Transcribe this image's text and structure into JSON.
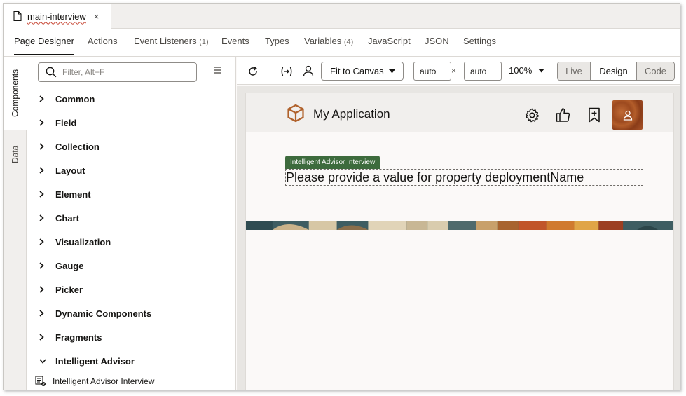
{
  "file_tab": {
    "name": "main-interview",
    "close_glyph": "×"
  },
  "designer_tabs": [
    {
      "label": "Page Designer",
      "count": ""
    },
    {
      "label": "Actions",
      "count": ""
    },
    {
      "label": "Event Listeners",
      "count": "(1)"
    },
    {
      "label": "Events",
      "count": ""
    },
    {
      "label": "Types",
      "count": ""
    },
    {
      "label": "Variables",
      "count": "(4)"
    },
    {
      "label": "JavaScript",
      "count": ""
    },
    {
      "label": "JSON",
      "count": ""
    },
    {
      "label": "Settings",
      "count": ""
    }
  ],
  "rail": {
    "components": "Components",
    "data": "Data"
  },
  "panel": {
    "search_placeholder": "Filter, Alt+F",
    "categories": [
      "Common",
      "Field",
      "Collection",
      "Layout",
      "Element",
      "Chart",
      "Visualization",
      "Gauge",
      "Picker",
      "Dynamic Components",
      "Fragments",
      "Intelligent Advisor"
    ],
    "expanded_category": "Intelligent Advisor",
    "component_item": "Intelligent Advisor Interview"
  },
  "toolbar": {
    "fit_label": "Fit to Canvas",
    "width_value": "auto",
    "height_value": "auto",
    "times_glyph": "×",
    "zoom": "100%",
    "modes": [
      "Live",
      "Design",
      "Code"
    ],
    "active_mode": "Design"
  },
  "canvas": {
    "app_title": "My Application",
    "component_tag": "Intelligent Advisor Interview",
    "component_message": "Please provide a value for property deploymentName"
  },
  "colors": {
    "accent_green": "#3d6b3d",
    "logo_brown": "#b0612b",
    "avatar_brown": "#a9542a"
  }
}
